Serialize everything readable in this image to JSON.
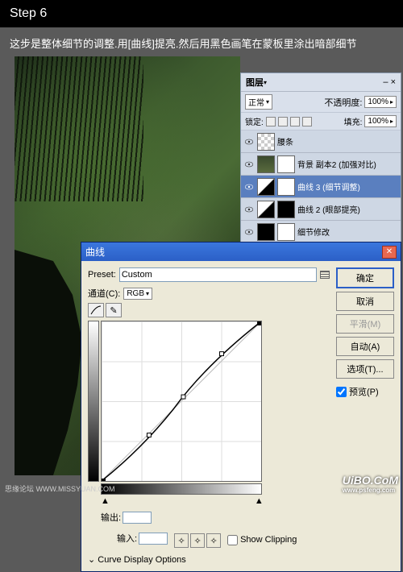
{
  "step": {
    "label": "Step 6"
  },
  "description": "这步是整体细节的调整.用[曲线]提亮.然后用黑色画笔在蒙板里涂出暗部细节",
  "layersPanel": {
    "title": "图层",
    "close": "×",
    "blendMode": "正常",
    "opacityLabel": "不透明度:",
    "opacityValue": "100%",
    "lockLabel": "锁定:",
    "fillLabel": "填充:",
    "fillValue": "100%",
    "layers": [
      {
        "name": "腰条"
      },
      {
        "name": "背景 副本2 (加强对比)"
      },
      {
        "name": "曲线 3 (细节调整)"
      },
      {
        "name": "曲线 2 (眼部提亮)"
      },
      {
        "name": "细节修改"
      }
    ]
  },
  "curvesDialog": {
    "title": "曲线",
    "presetLabel": "Preset:",
    "presetValue": "Custom",
    "channelLabel": "通道(C):",
    "channelValue": "RGB",
    "outputLabel": "输出:",
    "inputLabel": "输入:",
    "showClipping": "Show Clipping",
    "expandLabel": "Curve Display Options",
    "buttons": {
      "ok": "确定",
      "cancel": "取消",
      "smooth": "平滑(M)",
      "auto": "自动(A)",
      "options": "选项(T)...",
      "preview": "预览(P)"
    },
    "menuIcon": "E:"
  },
  "watermarks": {
    "bottomRight": "UiBO.CoM",
    "site": "www.psfeng.com",
    "bottomLeft": "思缘论坛  WWW.MISSYUAN.COM"
  }
}
